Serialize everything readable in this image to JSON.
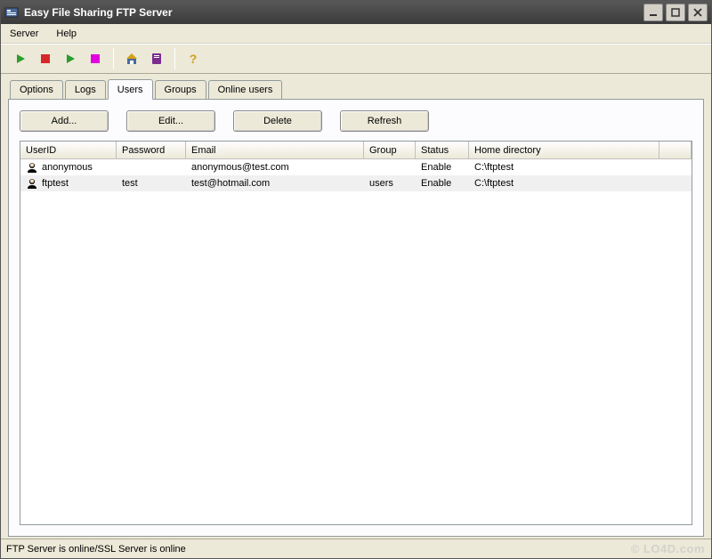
{
  "title": "Easy File Sharing FTP Server",
  "menu": {
    "server": "Server",
    "help": "Help"
  },
  "tabs": {
    "options": "Options",
    "logs": "Logs",
    "users": "Users",
    "groups": "Groups",
    "online": "Online users"
  },
  "buttons": {
    "add": "Add...",
    "edit": "Edit...",
    "delete": "Delete",
    "refresh": "Refresh"
  },
  "columns": {
    "userid": "UserID",
    "password": "Password",
    "email": "Email",
    "group": "Group",
    "status": "Status",
    "home": "Home directory"
  },
  "rows": [
    {
      "userid": "anonymous",
      "password": "",
      "email": "anonymous@test.com",
      "group": "",
      "status": "Enable",
      "home": "C:\\ftptest"
    },
    {
      "userid": "ftptest",
      "password": "test",
      "email": "test@hotmail.com",
      "group": "users",
      "status": "Enable",
      "home": "C:\\ftptest"
    }
  ],
  "status": "FTP Server is online/SSL Server is online",
  "watermark": "© LO4D.com"
}
